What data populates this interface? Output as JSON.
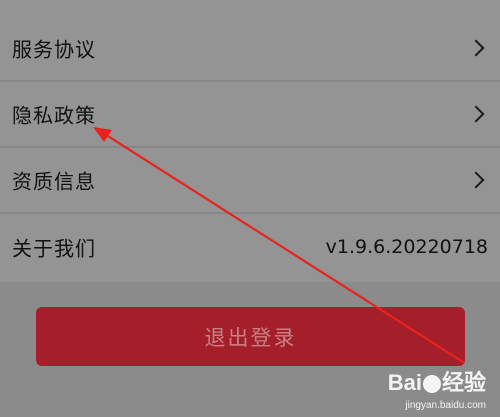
{
  "menu": {
    "items": [
      {
        "label": "服务协议",
        "has_chevron": true
      },
      {
        "label": "隐私政策",
        "has_chevron": true
      },
      {
        "label": "资质信息",
        "has_chevron": true
      },
      {
        "label": "关于我们",
        "value": "v1.9.6.20220718"
      }
    ]
  },
  "logout": {
    "label": "退出登录"
  },
  "annotation": {
    "color": "#e8231e"
  },
  "watermark": {
    "brand_left": "Bai",
    "brand_right": "经验",
    "url": "jingyan.baidu.com"
  }
}
